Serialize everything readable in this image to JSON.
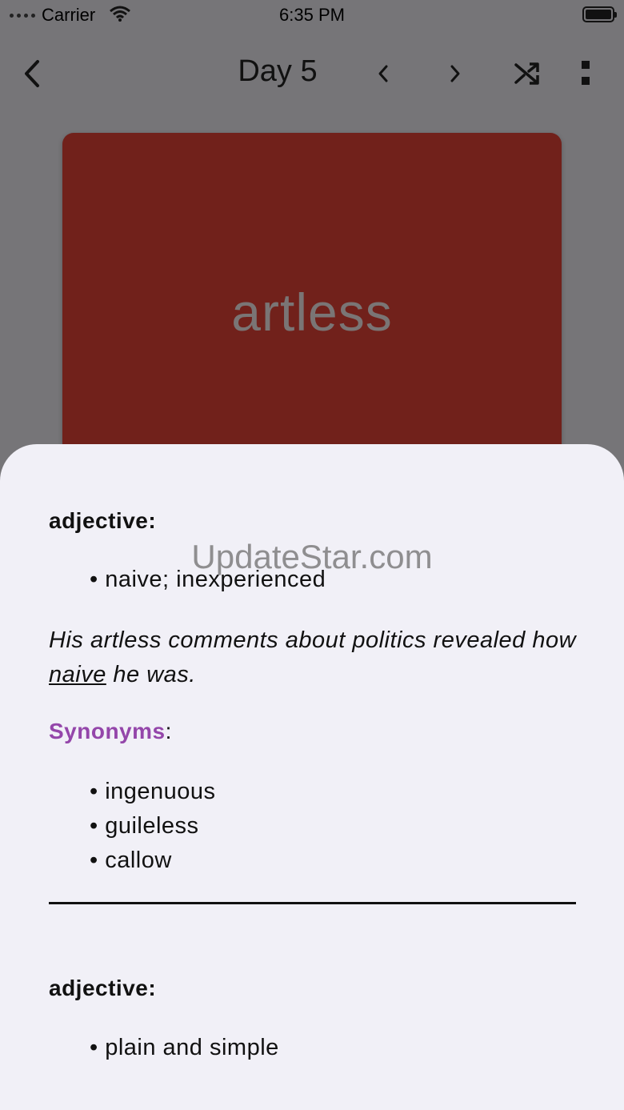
{
  "status": {
    "carrier": "Carrier",
    "time": "6:35 PM"
  },
  "nav": {
    "title": "Day 5",
    "icons": [
      "back-chevron-icon",
      "prev-chevron-icon",
      "next-chevron-icon",
      "shuffle-icon",
      "more-vertical-icon"
    ]
  },
  "card": {
    "word": "artless",
    "color": "#71211b"
  },
  "definitions": [
    {
      "part_of_speech": "adjective:",
      "meanings": [
        "naive; inexperienced"
      ],
      "example_before": "His artless comments about politics revealed how ",
      "example_highlight": "naive",
      "example_after": " he was.",
      "synonyms_label": "Synonyms",
      "synonyms_colon": ":",
      "synonyms": [
        "ingenuous",
        "guileless",
        "callow"
      ]
    },
    {
      "part_of_speech": "adjective:",
      "meanings": [
        "plain and simple"
      ]
    }
  ],
  "watermark": "UpdateStar.com",
  "colors": {
    "accent": "#9446aa",
    "sheet": "#f1f0f7",
    "overlay": "#767578"
  }
}
